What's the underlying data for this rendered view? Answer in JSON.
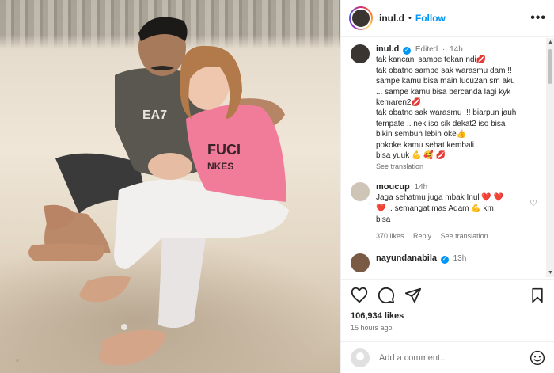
{
  "post": {
    "username": "inul.d",
    "follow_label": "Follow",
    "more_label": "•••",
    "edited_label": "Edited",
    "age": "14h",
    "caption_lines": [
      "tak kancani sampe tekan ndi💋",
      "tak obatno sampe sak warasmu dam !!",
      "sampe kamu bisa main lucu2an sm aku",
      "... sampe kamu bisa bercanda lagi kyk",
      "kemaren2💋",
      "tak obatno sak warasmu !!! biarpun jauh",
      "tempate .. nek iso sik dekat2 iso bisa",
      "bikin sembuh lebih oke👍",
      "pokoke kamu sehat kembali .",
      "bisa yuuk 💪 🥰 💋"
    ],
    "see_translation": "See translation",
    "likes": "106,934 likes",
    "posted_ago": "15 hours ago",
    "add_comment_placeholder": "Add a comment..."
  },
  "comments": [
    {
      "username": "moucup",
      "age": "14h",
      "lines": [
        "Jaga sehatmu juga mbak Inul ❤️ ❤️",
        "❤️ .. semangat mas Adam 💪 km",
        "bisa"
      ],
      "likes": "370 likes",
      "reply_label": "Reply",
      "see_translation": "See translation"
    },
    {
      "username": "nayundanabila",
      "age": "13h"
    }
  ],
  "icons": {
    "like": "heart-icon",
    "comment": "comment-bubble-icon",
    "share": "paper-plane-icon",
    "save": "bookmark-icon",
    "emoji": "smiley-icon",
    "verified": "verified-badge-icon"
  },
  "colors": {
    "accent": "#0095f6",
    "muted": "#737373",
    "text": "#262626"
  }
}
